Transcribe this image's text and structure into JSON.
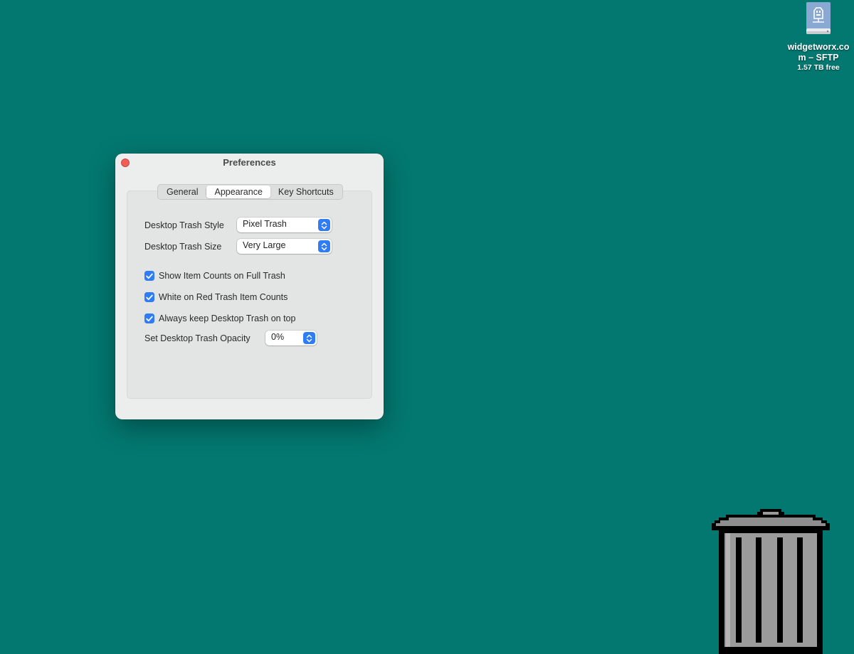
{
  "desktop": {
    "background_color": "#037870",
    "drive": {
      "name": "widgetworx.com – SFTP",
      "free": "1.57 TB free",
      "icon": "network-drive-icon"
    },
    "trash_icon": "pixel-trash-icon"
  },
  "window": {
    "title": "Preferences",
    "close_icon": "close-icon",
    "tabs": [
      {
        "label": "General",
        "selected": false
      },
      {
        "label": "Appearance",
        "selected": true
      },
      {
        "label": "Key Shortcuts",
        "selected": false
      }
    ],
    "style_row": {
      "label": "Desktop Trash Style",
      "value": "Pixel Trash"
    },
    "size_row": {
      "label": "Desktop Trash Size",
      "value": "Very Large"
    },
    "checkboxes": [
      {
        "label": "Show Item Counts on Full Trash",
        "checked": true
      },
      {
        "label": "White on Red Trash Item Counts",
        "checked": true
      },
      {
        "label": "Always keep Desktop Trash on top",
        "checked": true
      }
    ],
    "opacity_row": {
      "label": "Set Desktop Trash Opacity",
      "value": "0%"
    },
    "accent_color": "#2f7cf6"
  }
}
